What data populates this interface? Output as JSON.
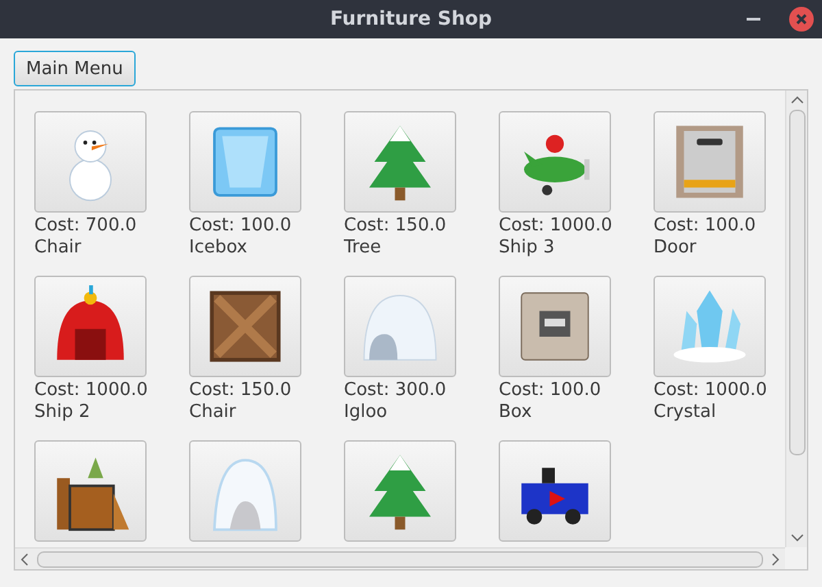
{
  "window": {
    "title": "Furniture Shop"
  },
  "main_menu_button": "Main Menu",
  "items": [
    {
      "kind": "snowman",
      "cost": "Cost: 700.0",
      "name": "Chair"
    },
    {
      "kind": "ice",
      "cost": "Cost: 100.0",
      "name": "Icebox"
    },
    {
      "kind": "tree",
      "cost": "Cost: 150.0",
      "name": "Tree"
    },
    {
      "kind": "plane",
      "cost": "Cost: 1000.0",
      "name": "Ship 3"
    },
    {
      "kind": "door",
      "cost": "Cost: 100.0",
      "name": "Door"
    },
    {
      "kind": "dome",
      "cost": "Cost: 1000.0",
      "name": "Ship 2"
    },
    {
      "kind": "crate",
      "cost": "Cost: 150.0",
      "name": "Chair"
    },
    {
      "kind": "igloo",
      "cost": "Cost: 300.0",
      "name": "Igloo"
    },
    {
      "kind": "box",
      "cost": "Cost: 100.0",
      "name": "Box"
    },
    {
      "kind": "crystal",
      "cost": "Cost: 1000.0",
      "name": "Crystal"
    },
    {
      "kind": "machine"
    },
    {
      "kind": "snowrock"
    },
    {
      "kind": "tree"
    },
    {
      "kind": "car"
    }
  ]
}
